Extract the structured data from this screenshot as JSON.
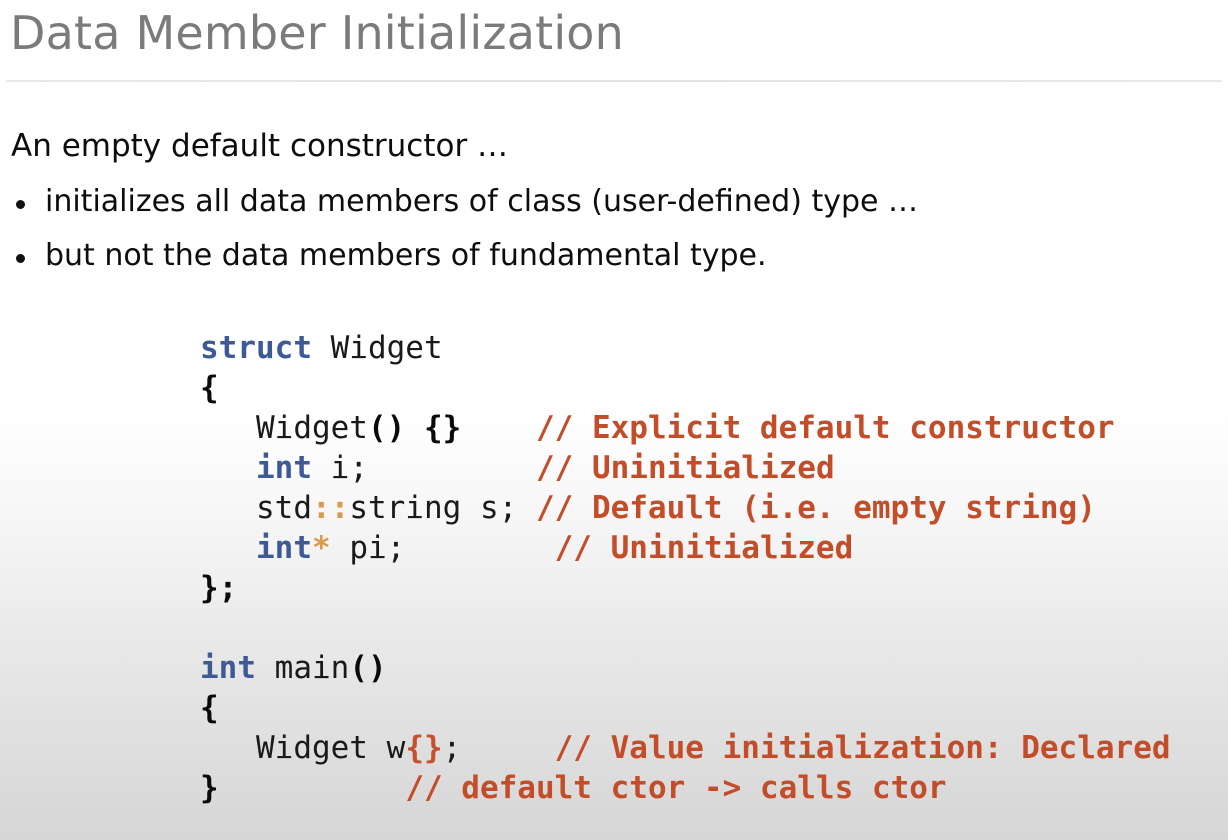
{
  "slide": {
    "title": "Data Member Initialization",
    "colors": {
      "title": "#7b7b7b",
      "body_text": "#0d0d0d",
      "keyword_blue": "#3d5a96",
      "comment_orange": "#c24d28",
      "operator_tan": "#d99a4e",
      "brace_highlight": "#c4512b",
      "rule": "#e6e6e6",
      "background_top": "#ffffff",
      "background_bottom": "#d6d6d6"
    }
  },
  "body": {
    "lead": "An empty default constructor …",
    "bullets": [
      "initializes all data members of class (user-defined) type …",
      "but not the data members of fundamental type."
    ]
  },
  "code": {
    "language": "cpp",
    "lines": [
      {
        "tokens": [
          {
            "t": "struct",
            "k": "kw"
          },
          {
            "t": " Widget",
            "k": "plain"
          }
        ]
      },
      {
        "tokens": [
          {
            "t": "{",
            "k": "punct"
          }
        ]
      },
      {
        "tokens": [
          {
            "t": "   Widget",
            "k": "plain"
          },
          {
            "t": "() {}",
            "k": "punct"
          },
          {
            "t": "    ",
            "k": "plain"
          },
          {
            "t": "// Explicit default constructor",
            "k": "comment"
          }
        ]
      },
      {
        "tokens": [
          {
            "t": "   ",
            "k": "plain"
          },
          {
            "t": "int",
            "k": "kw"
          },
          {
            "t": " i;",
            "k": "plain"
          },
          {
            "t": "         ",
            "k": "plain"
          },
          {
            "t": "// Uninitialized",
            "k": "comment"
          }
        ]
      },
      {
        "tokens": [
          {
            "t": "   std",
            "k": "plain"
          },
          {
            "t": "::",
            "k": "op"
          },
          {
            "t": "string s; ",
            "k": "plain"
          },
          {
            "t": "// Default (i.e. empty string)",
            "k": "comment"
          }
        ]
      },
      {
        "tokens": [
          {
            "t": "   ",
            "k": "plain"
          },
          {
            "t": "int",
            "k": "kw"
          },
          {
            "t": "*",
            "k": "op"
          },
          {
            "t": " pi;",
            "k": "plain"
          },
          {
            "t": "        ",
            "k": "plain"
          },
          {
            "t": "// Uninitialized",
            "k": "comment"
          }
        ]
      },
      {
        "tokens": [
          {
            "t": "};",
            "k": "punct"
          }
        ]
      },
      {
        "tokens": []
      },
      {
        "tokens": [
          {
            "t": "int",
            "k": "kw"
          },
          {
            "t": " main",
            "k": "plain"
          },
          {
            "t": "()",
            "k": "punct"
          }
        ]
      },
      {
        "tokens": [
          {
            "t": "{",
            "k": "punct"
          }
        ]
      },
      {
        "tokens": [
          {
            "t": "   Widget w",
            "k": "plain"
          },
          {
            "t": "{}",
            "k": "brace-h"
          },
          {
            "t": ";",
            "k": "plain"
          },
          {
            "t": "     ",
            "k": "plain"
          },
          {
            "t": "// Value initialization: Declared",
            "k": "comment"
          }
        ]
      },
      {
        "tokens": [
          {
            "t": "}",
            "k": "punct"
          },
          {
            "t": "          ",
            "k": "plain"
          },
          {
            "t": "// default ctor -> calls ctor",
            "k": "comment"
          }
        ]
      }
    ]
  }
}
